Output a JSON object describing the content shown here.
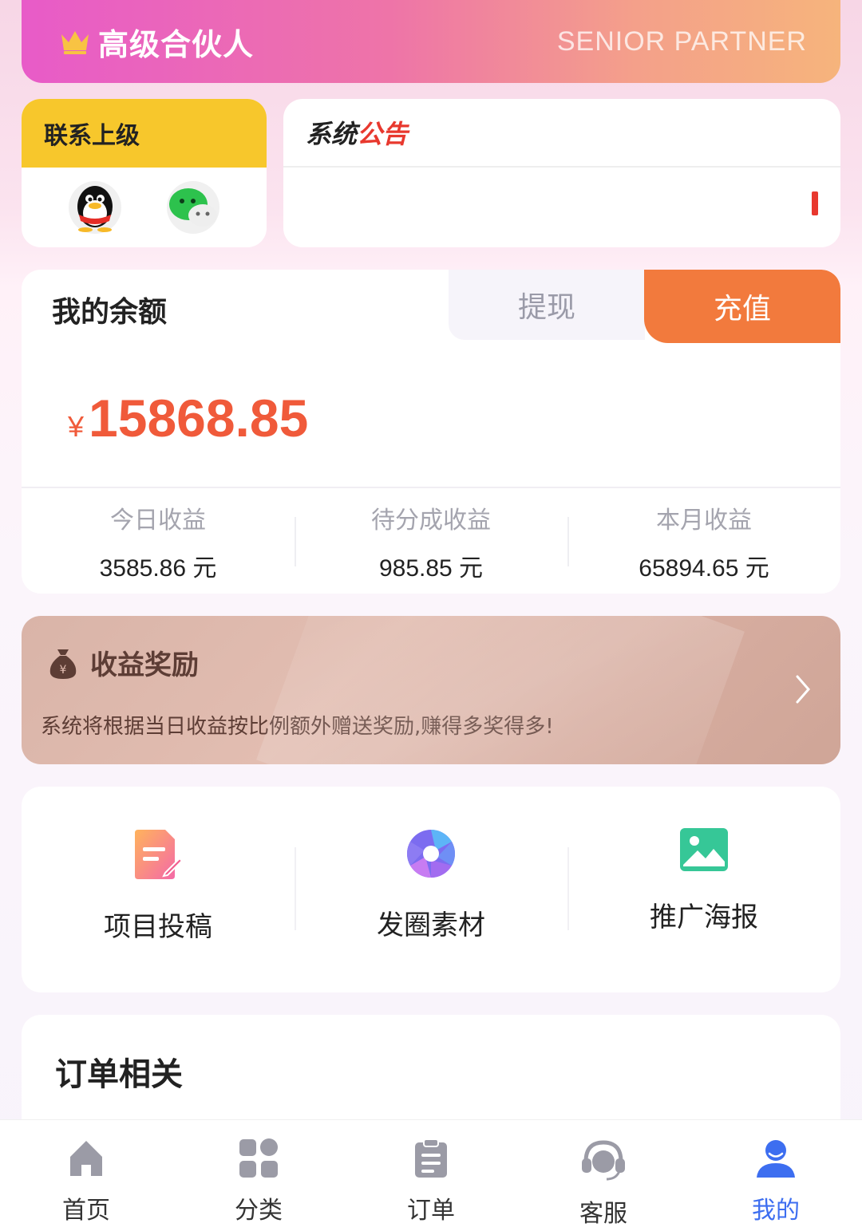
{
  "banner": {
    "title": "高级合伙人",
    "subtitle": "SENIOR PARTNER",
    "icon": "crown-icon"
  },
  "contact": {
    "title": "联系上级",
    "icons": [
      "qq-icon",
      "wechat-icon"
    ]
  },
  "notice": {
    "title_part1": "系统",
    "title_part2": "公告"
  },
  "balance": {
    "title": "我的余额",
    "withdraw_label": "提现",
    "recharge_label": "充值",
    "currency": "¥",
    "amount": "15868.85",
    "stats": [
      {
        "label": "今日收益",
        "value": "3585.86 元"
      },
      {
        "label": "待分成收益",
        "value": "985.85 元"
      },
      {
        "label": "本月收益",
        "value": "65894.65 元"
      }
    ]
  },
  "reward": {
    "title": "收益奖励",
    "description": "系统将根据当日收益按比例额外赠送奖励,赚得多奖得多!",
    "icon": "money-bag-icon"
  },
  "tools": [
    {
      "label": "项目投稿",
      "icon": "document-edit-icon"
    },
    {
      "label": "发圈素材",
      "icon": "aperture-icon"
    },
    {
      "label": "推广海报",
      "icon": "image-icon"
    }
  ],
  "orders": {
    "title": "订单相关"
  },
  "tabbar": [
    {
      "label": "首页",
      "icon": "home-icon"
    },
    {
      "label": "分类",
      "icon": "grid-icon"
    },
    {
      "label": "订单",
      "icon": "clipboard-icon"
    },
    {
      "label": "客服",
      "icon": "headset-icon"
    },
    {
      "label": "我的",
      "icon": "user-icon",
      "active": true
    }
  ],
  "colors": {
    "accent": "#f27a3d",
    "amount": "#f05a3a",
    "tab_active": "#3d6ef0",
    "contact_header": "#f7c72c"
  }
}
